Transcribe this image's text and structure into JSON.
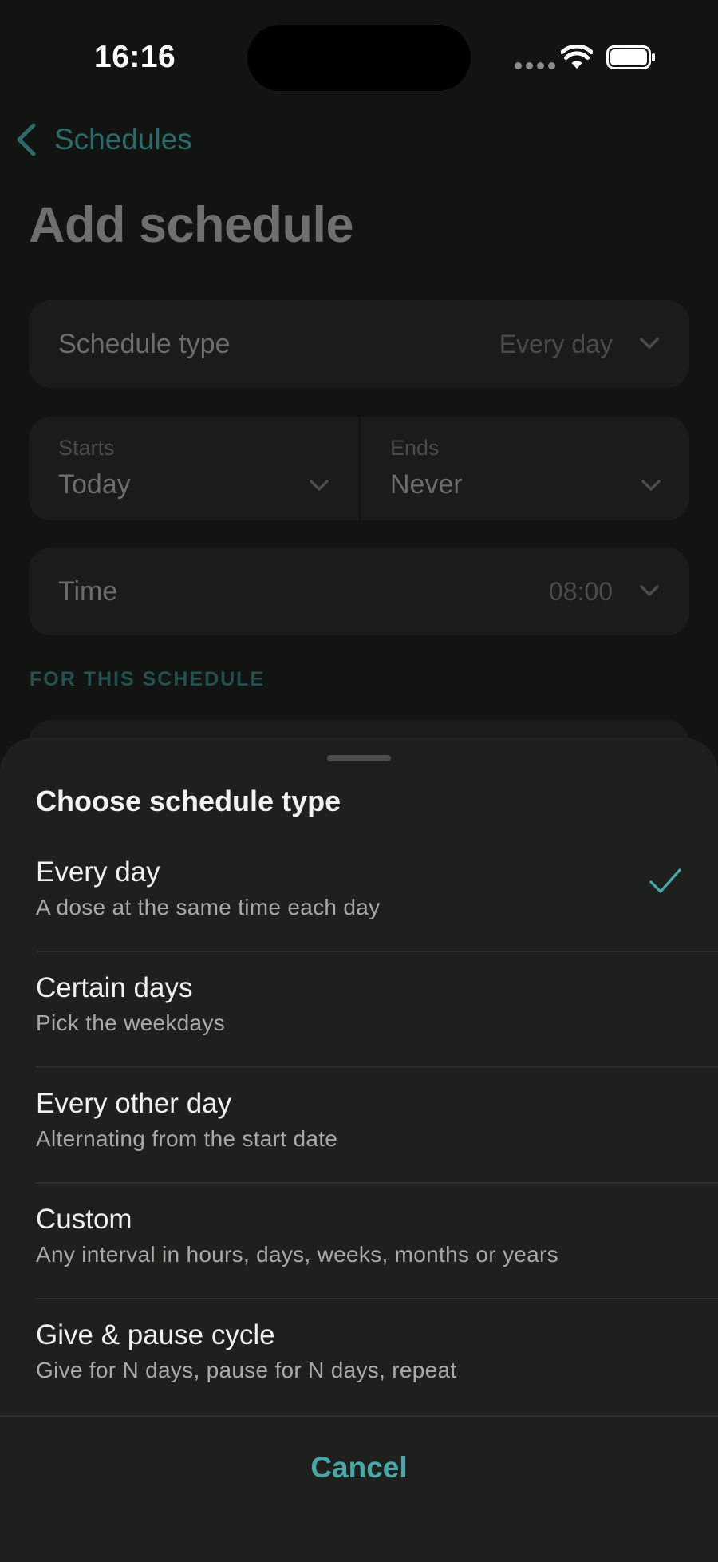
{
  "status_bar": {
    "time": "16:16"
  },
  "nav": {
    "back_label": "Schedules"
  },
  "page": {
    "title": "Add schedule"
  },
  "form": {
    "schedule_type": {
      "label": "Schedule type",
      "value": "Every day"
    },
    "starts": {
      "label": "Starts",
      "value": "Today"
    },
    "ends": {
      "label": "Ends",
      "value": "Never"
    },
    "time": {
      "label": "Time",
      "value": "08:00"
    },
    "section_header": "FOR THIS SCHEDULE"
  },
  "sheet": {
    "title": "Choose schedule type",
    "options": [
      {
        "title": "Every day",
        "subtitle": "A dose at the same time each day",
        "selected": true
      },
      {
        "title": "Certain days",
        "subtitle": "Pick the weekdays",
        "selected": false
      },
      {
        "title": "Every other day",
        "subtitle": "Alternating from the start date",
        "selected": false
      },
      {
        "title": "Custom",
        "subtitle": "Any interval in hours, days, weeks, months or years",
        "selected": false
      },
      {
        "title": "Give & pause cycle",
        "subtitle": "Give for N days, pause for N days, repeat",
        "selected": false
      }
    ],
    "cancel_label": "Cancel"
  },
  "colors": {
    "accent": "#4aa7a8",
    "sheet_background": "#1d201d",
    "page_background": "#121412"
  }
}
